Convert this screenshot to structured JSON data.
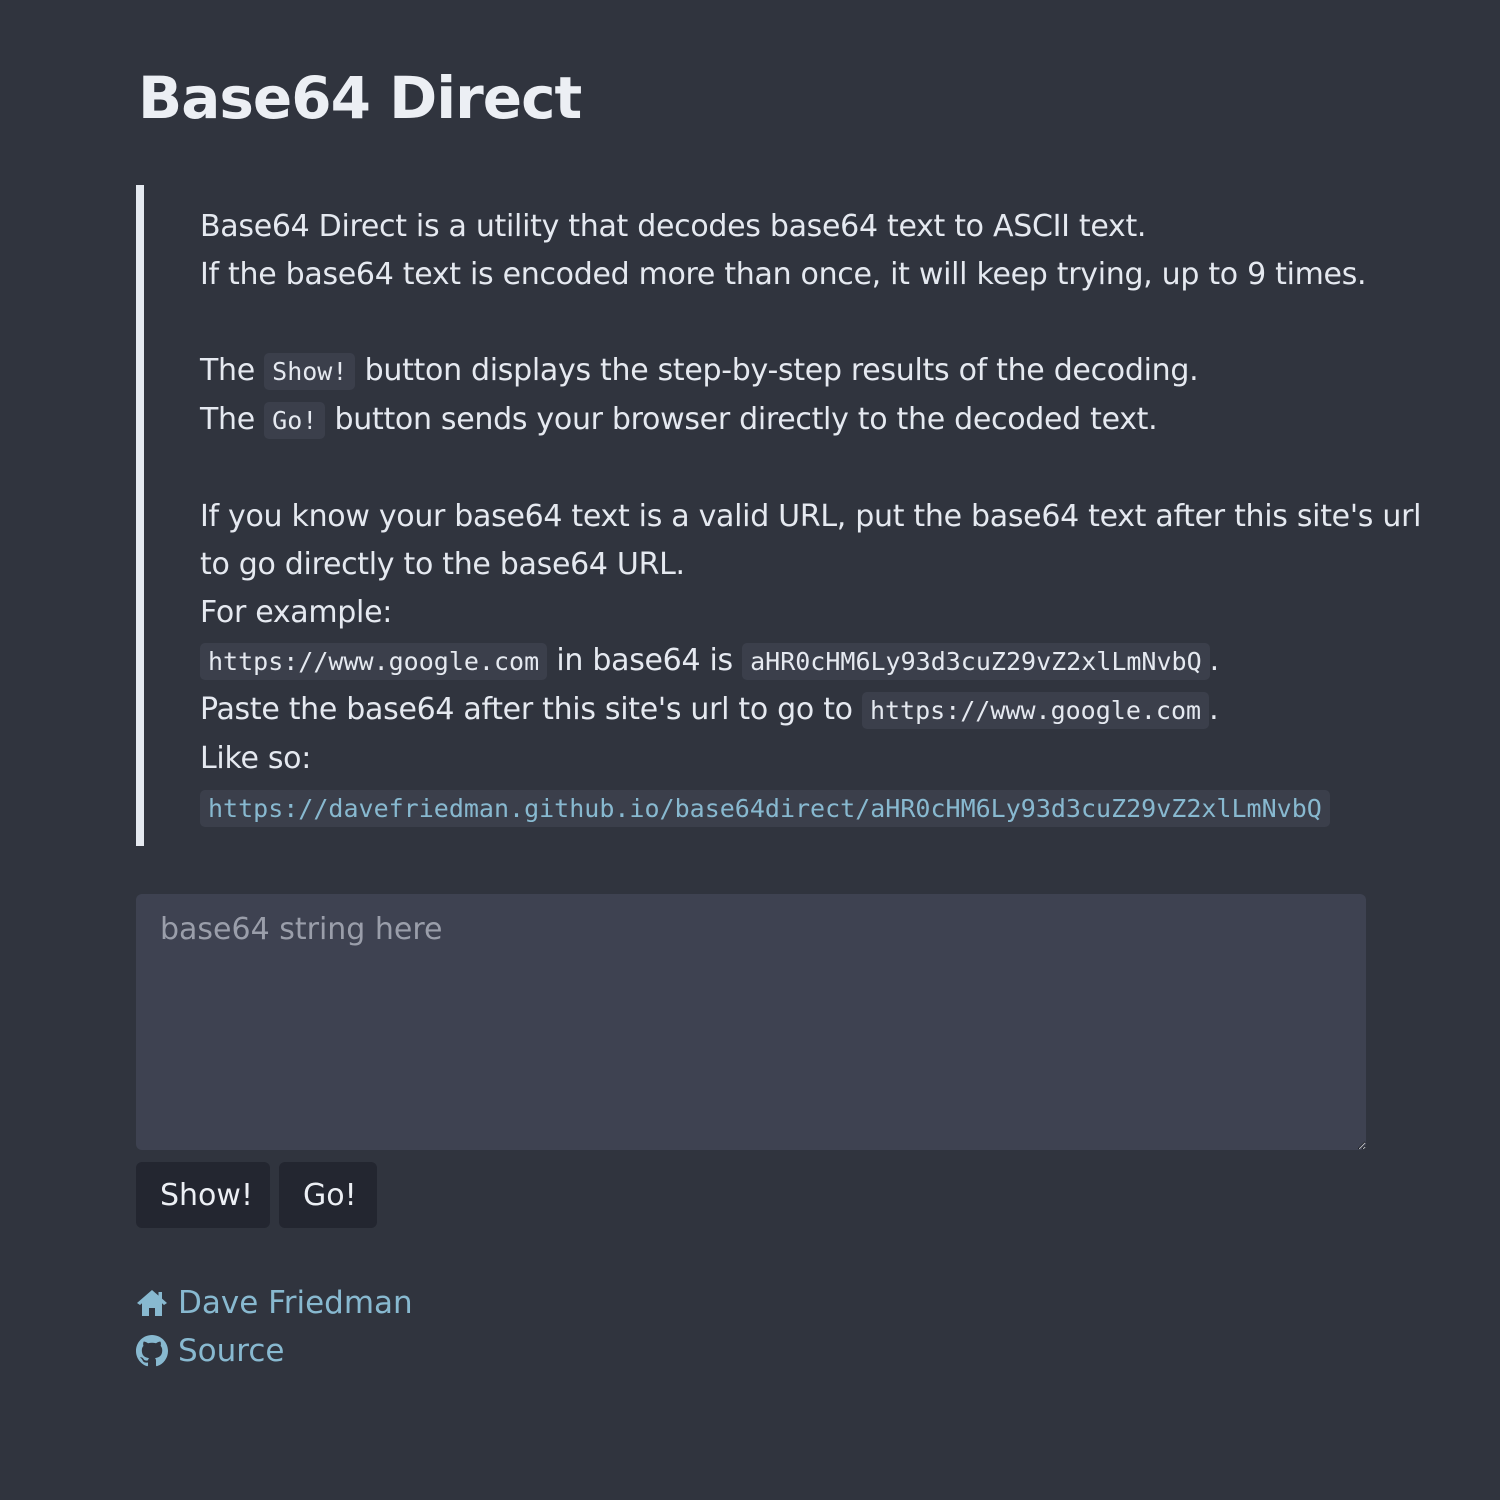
{
  "page": {
    "title": "Base64 Direct"
  },
  "intro": {
    "line1": "Base64 Direct is a utility that decodes base64 text to ASCII text.",
    "line2": "If the base64 text is encoded more than once, it will keep trying, up to 9 times.",
    "line3_pre": "The ",
    "line3_code": "Show!",
    "line3_post": " button displays the step-by-step results of the decoding.",
    "line4_pre": "The ",
    "line4_code": "Go!",
    "line4_post": " button sends your browser directly to the decoded text.",
    "line5": "If you know your base64 text is a valid URL, put the base64 text after this site's url",
    "line6": "to go directly to the base64 URL.",
    "line7": "For example:",
    "line8_code1": "https://www.google.com",
    "line8_mid": " in base64 is ",
    "line8_code2": "aHR0cHM6Ly93d3cuZ29vZ2xlLmNvbQ",
    "line8_end": ".",
    "line9_pre": "Paste the base64 after this site's url to go to ",
    "line9_code": "https://www.google.com",
    "line9_end": ".",
    "line10": "Like so:",
    "example_link": "https://davefriedman.github.io/base64direct/aHR0cHM6Ly93d3cuZ29vZ2xlLmNvbQ"
  },
  "input": {
    "placeholder": "base64 string here",
    "value": ""
  },
  "buttons": {
    "show_label": "Show!",
    "go_label": "Go!"
  },
  "footer": {
    "home_icon": "home-icon",
    "home_label": "Dave Friedman",
    "source_icon": "github-icon",
    "source_label": "Source"
  },
  "colors": {
    "background": "#30343e",
    "link": "#88b9d0",
    "code_background": "#3b3f4b"
  }
}
